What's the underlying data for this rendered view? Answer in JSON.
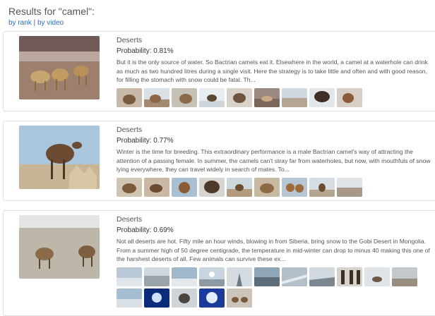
{
  "header": {
    "title": "Results for \"camel\":",
    "sort_by_rank": "by rank",
    "separator": " | ",
    "sort_by_video": "by video"
  },
  "results": [
    {
      "category": "Deserts",
      "probability": "Probability: 0.81%",
      "description": "But it is the only source of water. So Bactrian camels eat it. Elsewhere in the world, a camel at a waterhole can drink as much as two hundred litres during a single visit. Here the strategy is to take little and often and with good reason, for filling the stomach with snow could be fatal. Th...",
      "thumb_count": 9
    },
    {
      "category": "Deserts",
      "probability": "Probability: 0.77%",
      "description": "Winter is the time for breeding. This extraordinary performance is a male Bactrian camel's way of attracting the attention of a passing female. In summer, the camels can't stray far from waterholes, but now, with mouthfuls of snow lying everywhere, they can travel widely in search of mates. To...",
      "thumb_count": 9
    },
    {
      "category": "Deserts",
      "probability": "Probability: 0.69%",
      "description": "Not all deserts are hot. Fifty mile an hour winds, blowing in from Siberia, bring snow to the Gobi Desert in Mongolia. From a summer high of 50 degree centigrade, the temperature in mid-winter can drop to minus 40 making this one of the harshest deserts of all. Few animals can survive these ex...",
      "thumb_count": 16
    }
  ]
}
